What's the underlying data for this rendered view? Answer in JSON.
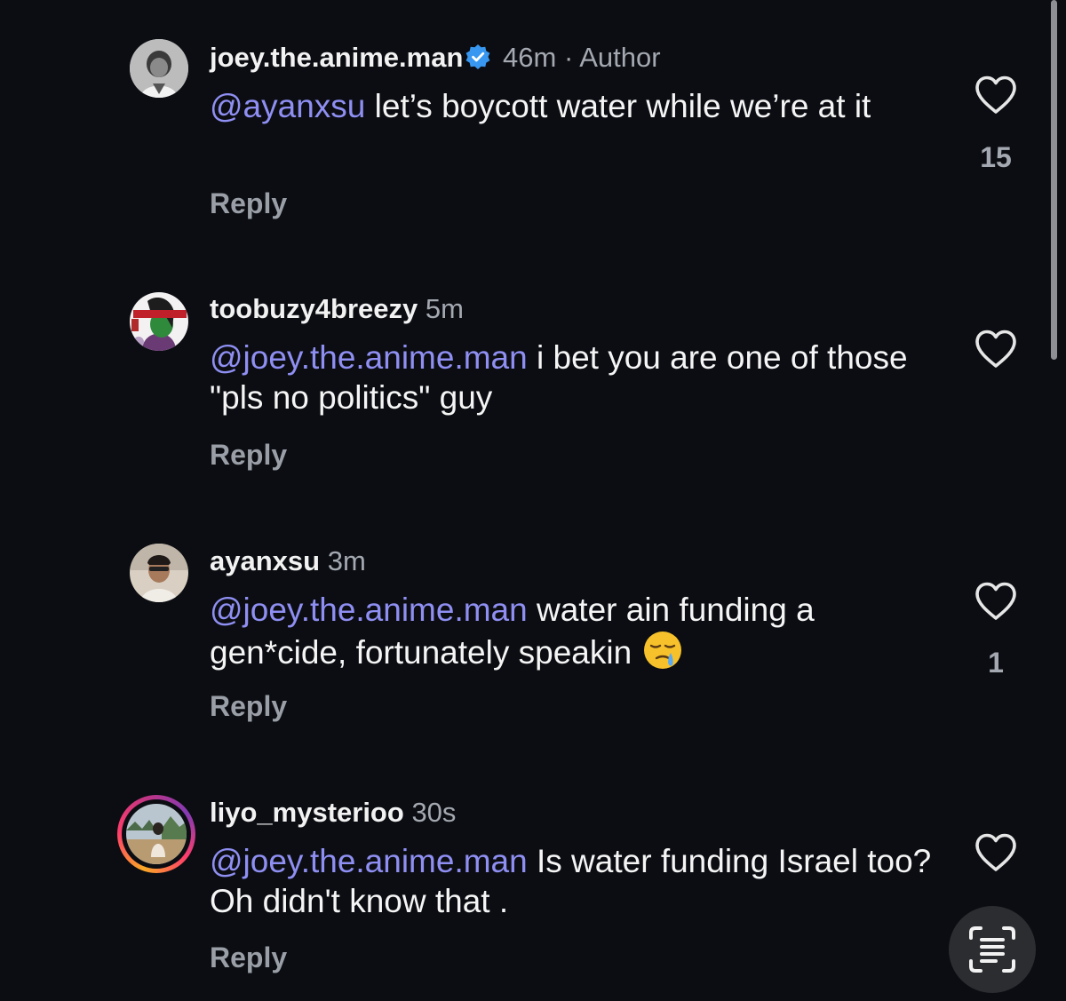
{
  "comments": [
    {
      "username": "joey.the.anime.man",
      "verified": true,
      "time": "46m",
      "separator": "·",
      "author_label": "Author",
      "mention": "@ayanxsu",
      "text": " let’s boycott water while we’re at it",
      "reply_label": "Reply",
      "like_count": "15",
      "avatar_icon": "profile-photo"
    },
    {
      "username": "toobuzy4breezy",
      "time": "5m",
      "mention": "@joey.the.anime.man",
      "text": " i bet you are one of those \"pls no politics\" guy",
      "reply_label": "Reply",
      "like_count": "",
      "avatar_icon": "profile-photo"
    },
    {
      "username": "ayanxsu",
      "time": "3m",
      "mention": "@joey.the.anime.man",
      "text": " water ain funding a gen*cide, fortunately speakin ",
      "emoji": "sleepy-face-emoji",
      "reply_label": "Reply",
      "like_count": "1",
      "avatar_icon": "profile-photo"
    },
    {
      "username": "liyo_mysterioo",
      "time": "30s",
      "mention": "@joey.the.anime.man",
      "text": " Is water funding Israel too?Oh didn't know that .",
      "reply_label": "Reply",
      "like_count": "",
      "avatar_icon": "profile-photo-with-story-ring"
    }
  ],
  "colors": {
    "background": "#0b0d12",
    "mention": "#8f8ff3",
    "verified": "#3897f0",
    "muted": "#a4a8b0"
  },
  "icons": {
    "like": "heart-outline-icon",
    "scan": "text-scan-icon"
  }
}
